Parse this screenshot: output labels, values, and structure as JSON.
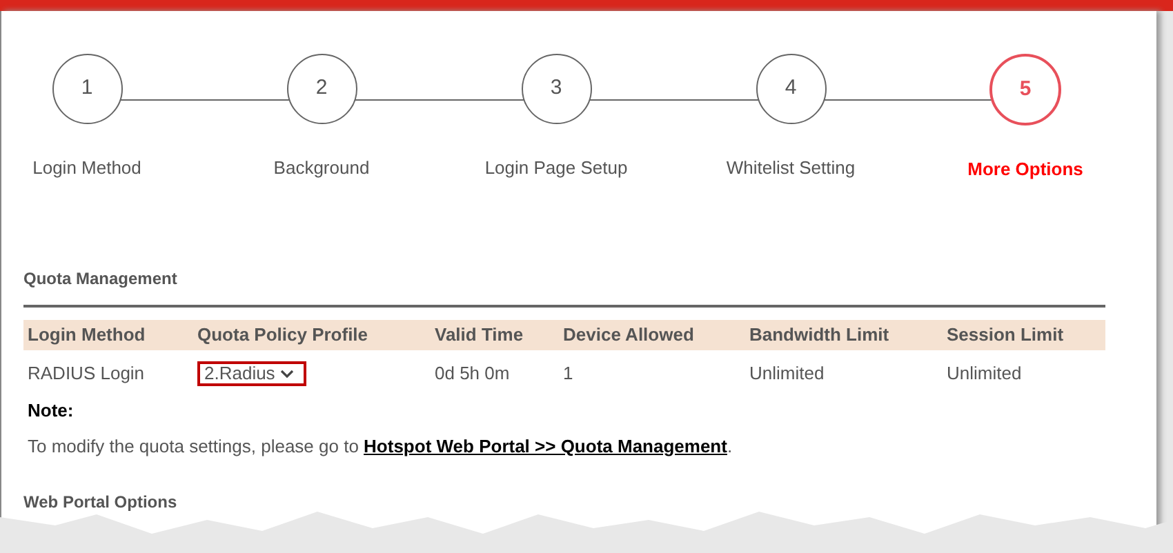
{
  "steps": [
    {
      "number": "1",
      "label": "Login Method",
      "selected": false
    },
    {
      "number": "2",
      "label": "Background",
      "selected": false
    },
    {
      "number": "3",
      "label": "Login Page Setup",
      "selected": false
    },
    {
      "number": "4",
      "label": "Whitelist Setting",
      "selected": false
    },
    {
      "number": "5",
      "label": "More Options",
      "selected": true
    }
  ],
  "quota_management": {
    "title": "Quota Management",
    "table": {
      "columns": [
        "Login Method",
        "Quota Policy Profile",
        "Valid Time",
        "Device Allowed",
        "Bandwidth Limit",
        "Session Limit"
      ],
      "rows": [
        {
          "login_method": "RADIUS Login",
          "quota_policy_profile": "2.Radius",
          "valid_time": "0d 5h 0m",
          "device_allowed": "1",
          "bandwidth_limit": "Unlimited",
          "session_limit": "Unlimited"
        }
      ]
    },
    "note_label": "Note:",
    "note_text": "To modify the quota settings, please go to ",
    "note_link": "Hotspot Web Portal >> Quota Management",
    "note_end": "."
  },
  "web_portal_options": {
    "title": "Web Portal Options"
  }
}
